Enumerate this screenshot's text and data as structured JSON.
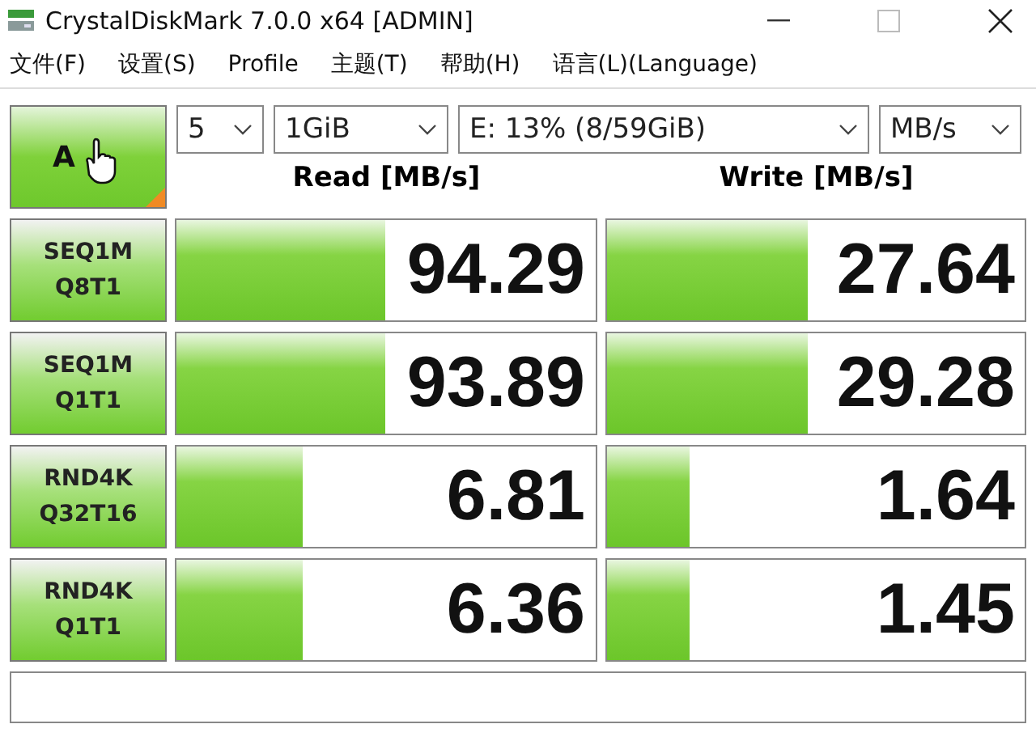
{
  "window": {
    "title": "CrystalDiskMark 7.0.0 x64 [ADMIN]"
  },
  "menu": [
    "文件(F)",
    "设置(S)",
    "Profile",
    "主题(T)",
    "帮助(H)",
    "语言(L)(Language)"
  ],
  "all_button": {
    "label": "A"
  },
  "selectors": [
    {
      "value": "5"
    },
    {
      "value": "1GiB"
    },
    {
      "value": "E: 13% (8/59GiB)"
    },
    {
      "value": "MB/s"
    }
  ],
  "headers": [
    "Read [MB/s]",
    "Write [MB/s]"
  ],
  "tests": [
    {
      "label_1": "SEQ1M",
      "label_2": "Q8T1",
      "read": {
        "value": "94.29",
        "level": 0.5
      },
      "write": {
        "value": "27.64",
        "level": 0.48
      }
    },
    {
      "label_1": "SEQ1M",
      "label_2": "Q1T1",
      "read": {
        "value": "93.89",
        "level": 0.5
      },
      "write": {
        "value": "29.28",
        "level": 0.48
      }
    },
    {
      "label_1": "RND4K",
      "label_2": "Q32T16",
      "read": {
        "value": "6.81",
        "level": 0.3
      },
      "write": {
        "value": "1.64",
        "level": 0.2
      }
    },
    {
      "label_1": "RND4K",
      "label_2": "Q1T1",
      "read": {
        "value": "6.36",
        "level": 0.3
      },
      "write": {
        "value": "1.45",
        "level": 0.2
      }
    }
  ]
}
